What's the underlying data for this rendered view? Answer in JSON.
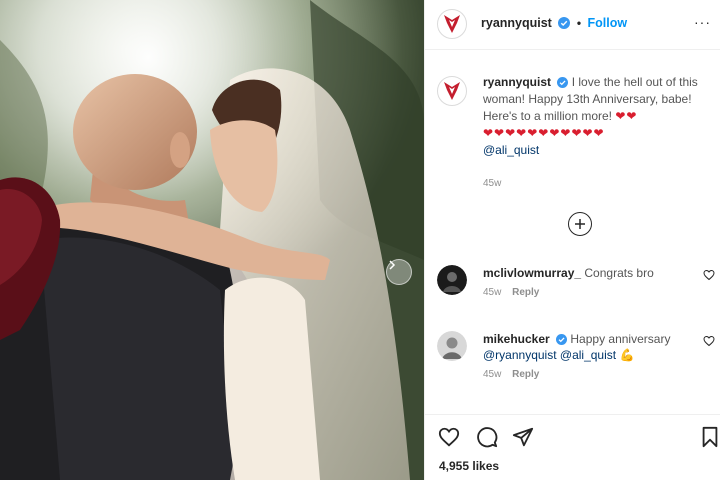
{
  "post": {
    "username": "ryannyquist",
    "separator": "•",
    "follow_label": "Follow",
    "more_label": "···"
  },
  "caption": {
    "username": "ryannyquist",
    "text": "I love the hell out of this woman! Happy 13th Anniversary, babe! Here's to a million more!",
    "hearts_inline": "❤❤",
    "hearts_row": "❤❤❤❤❤❤❤❤❤❤❤",
    "mention": "@ali_quist",
    "time": "45w"
  },
  "comments": [
    {
      "username": "mclivlowmurray_",
      "text": "Congrats bro",
      "time": "45w",
      "reply_label": "Reply"
    },
    {
      "username": "mikehucker",
      "text": "Happy anniversary",
      "mentions": "@ryannyquist @ali_quist",
      "emoji": "💪",
      "time": "45w",
      "reply_label": "Reply"
    }
  ],
  "footer": {
    "likes": "4,955 likes"
  },
  "icons": {
    "brand_logo": "red-winged-logo-icon",
    "verified": "verified-badge-icon",
    "load_more": "plus-circle-icon",
    "like": "heart-outline-icon",
    "comment": "comment-bubble-icon",
    "share": "paper-plane-icon",
    "save": "bookmark-icon",
    "next": "chevron-right-icon"
  },
  "colors": {
    "accent": "#0095f6",
    "verified": "#3897f0",
    "heart": "#d91e2f",
    "text": "#262626",
    "muted": "#8e8e8e"
  }
}
